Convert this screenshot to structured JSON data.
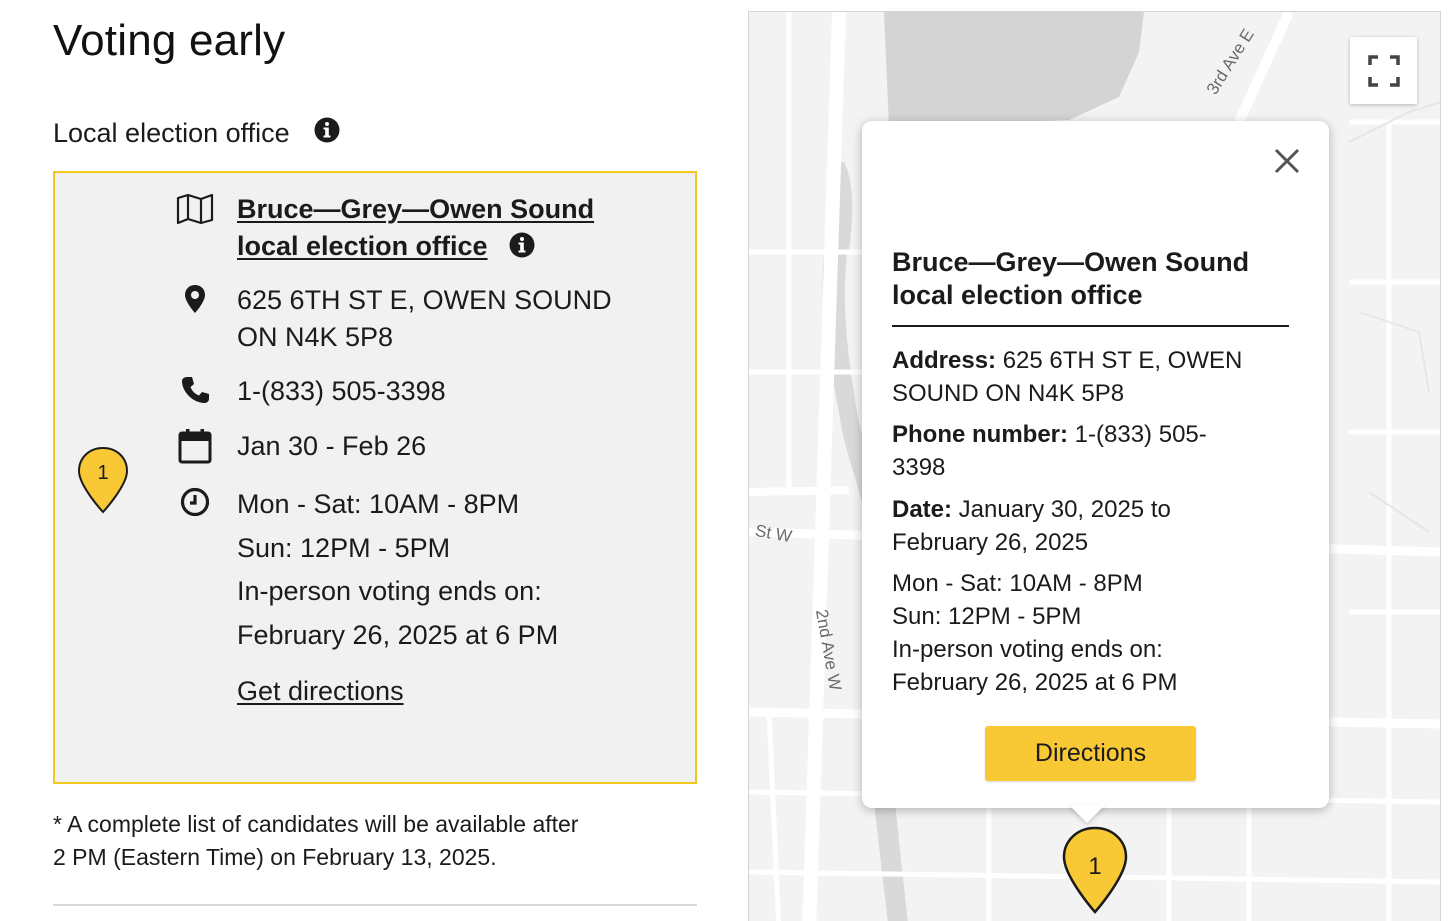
{
  "page": {
    "title": "Voting early"
  },
  "section": {
    "heading": "Local election office"
  },
  "office_card": {
    "marker_number": "1",
    "office_name_line1": "Bruce—Grey—Owen Sound",
    "office_name_line2": "local election office",
    "address_line1": "625 6TH ST E, OWEN SOUND",
    "address_line2": "ON N4K 5P8",
    "phone": "1-(833) 505-3398",
    "dates": "Jan 30 - Feb 26",
    "hours": [
      "Mon - Sat: 10AM - 8PM",
      "Sun: 12PM - 5PM",
      "In-person voting ends on:",
      "February 26, 2025 at 6 PM"
    ],
    "directions_label": "Get directions"
  },
  "footnote": {
    "line1": "* A complete list of candidates will be available after",
    "line2": "2 PM (Eastern Time) on February 13, 2025."
  },
  "map": {
    "street_labels": [
      "3rd Ave E",
      "St W",
      "2nd Ave W"
    ],
    "marker_number": "1",
    "popup": {
      "title_line1": "Bruce—Grey—Owen Sound",
      "title_line2": "local election office",
      "address_label": "Address:",
      "address_value_line1": " 625 6TH ST E, OWEN",
      "address_value_line2": "SOUND ON N4K 5P8",
      "phone_label": "Phone number:",
      "phone_value_line1": " 1-(833) 505-",
      "phone_value_line2": "3398",
      "date_label": "Date:",
      "date_value_line1": " January 30, 2025 to",
      "date_value_line2": "February 26, 2025",
      "hours": [
        "Mon - Sat: 10AM - 8PM",
        "Sun: 12PM - 5PM",
        "In-person voting ends on:",
        "February 26, 2025 at 6 PM"
      ],
      "button_label": "Directions"
    }
  },
  "colors": {
    "accent_yellow": "#f9c935",
    "card_border": "#f2c81d",
    "card_bg": "#f1f1f1"
  },
  "icons": [
    "info-icon",
    "map-icon",
    "location-pin-icon",
    "phone-icon",
    "calendar-icon",
    "clock-icon",
    "fullscreen-icon",
    "close-icon",
    "map-marker-icon"
  ]
}
